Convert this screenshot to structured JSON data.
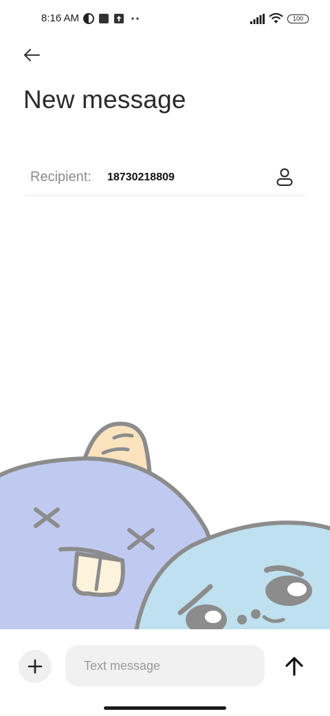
{
  "status_bar": {
    "time": "8:16 AM",
    "battery": "100",
    "icons": [
      "vpn-half-circle-icon",
      "app-square-icon",
      "upload-icon",
      "more-dots-icon",
      "signal-icon",
      "wifi-icon",
      "battery-icon"
    ]
  },
  "header": {
    "title": "New message",
    "back_icon": "arrow-left-icon"
  },
  "recipient": {
    "label": "Recipient:",
    "value": "18730218809",
    "contact_icon": "person-icon"
  },
  "composer": {
    "placeholder": "Text message",
    "value": "",
    "add_icon": "plus-icon",
    "send_icon": "arrow-up-icon"
  },
  "colors": {
    "monster_blue": "#c0caf0",
    "monster_cyan": "#bfe0ef",
    "horn": "#fbe3bd",
    "outline": "#8c8c8c",
    "input_bg": "#f1f1f1"
  }
}
